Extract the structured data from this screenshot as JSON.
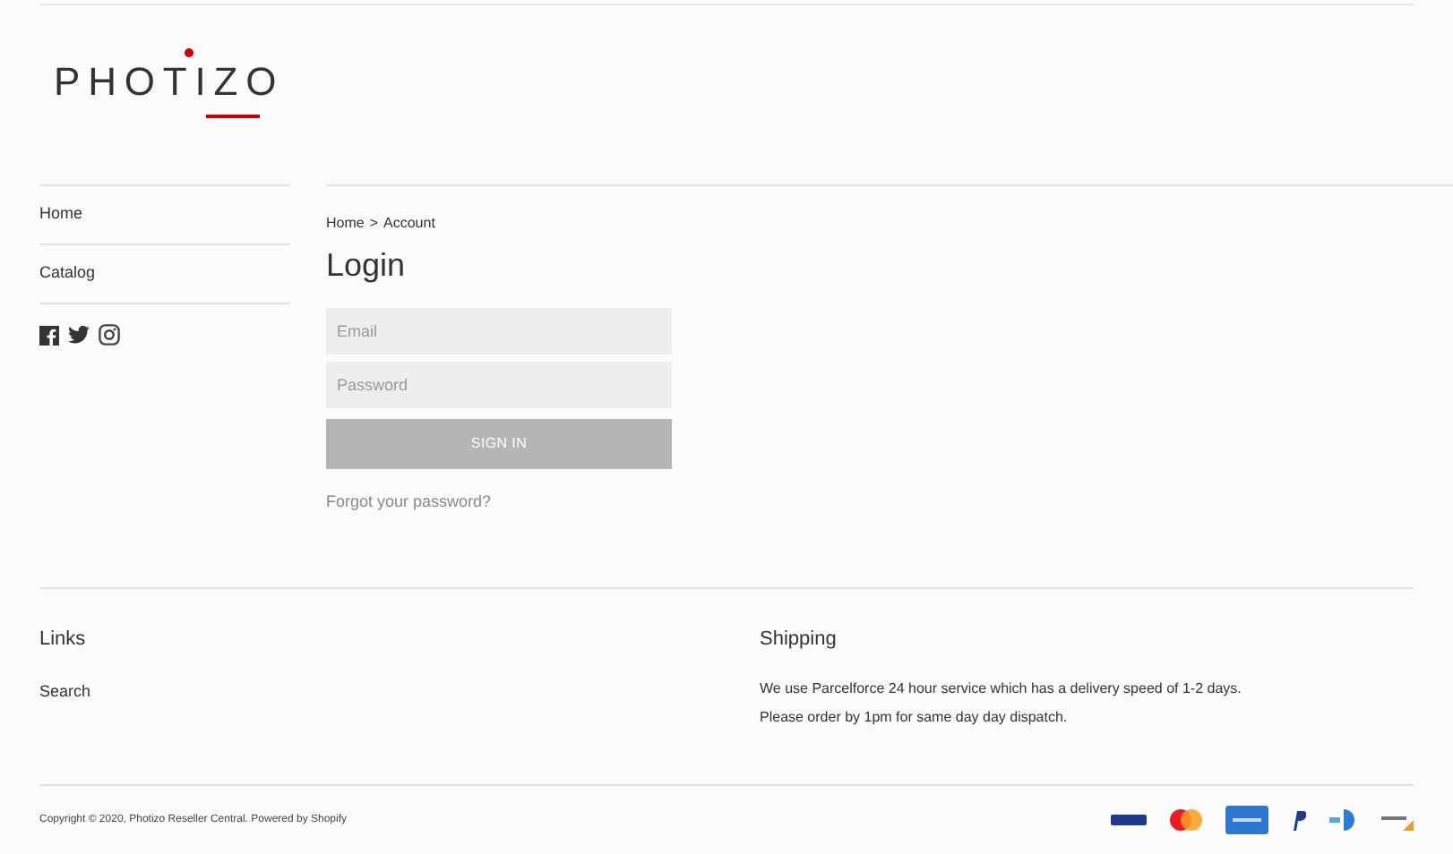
{
  "logo": {
    "name": "PHOTIZO"
  },
  "sidebar": {
    "items": [
      {
        "label": "Home"
      },
      {
        "label": "Catalog"
      }
    ],
    "social": [
      {
        "kind": "facebook"
      },
      {
        "kind": "twitter"
      },
      {
        "kind": "instagram"
      }
    ]
  },
  "breadcrumb": {
    "items": [
      "Home",
      "Account"
    ],
    "separator": ">"
  },
  "login": {
    "title": "Login",
    "email": {
      "placeholder": "Email"
    },
    "password": {
      "placeholder": "Password"
    },
    "submit": "SIGN IN",
    "forgot": "Forgot your password?"
  },
  "footer": {
    "links": {
      "title": "Links",
      "items": [
        "Search"
      ]
    },
    "shipping": {
      "title": "Shipping",
      "lines": [
        "We use Parcelforce 24 hour service which has a delivery speed of 1-2 days.",
        "Please order by 1pm for same day day dispatch."
      ]
    },
    "copyright": "Copyright © 2020, Photizo Reseller Central. Powered by Shopify",
    "payments": [
      {
        "kind": "visa"
      },
      {
        "kind": "mastercard"
      },
      {
        "kind": "amex"
      },
      {
        "kind": "paypal"
      },
      {
        "kind": "diners"
      },
      {
        "kind": "discover"
      }
    ]
  }
}
